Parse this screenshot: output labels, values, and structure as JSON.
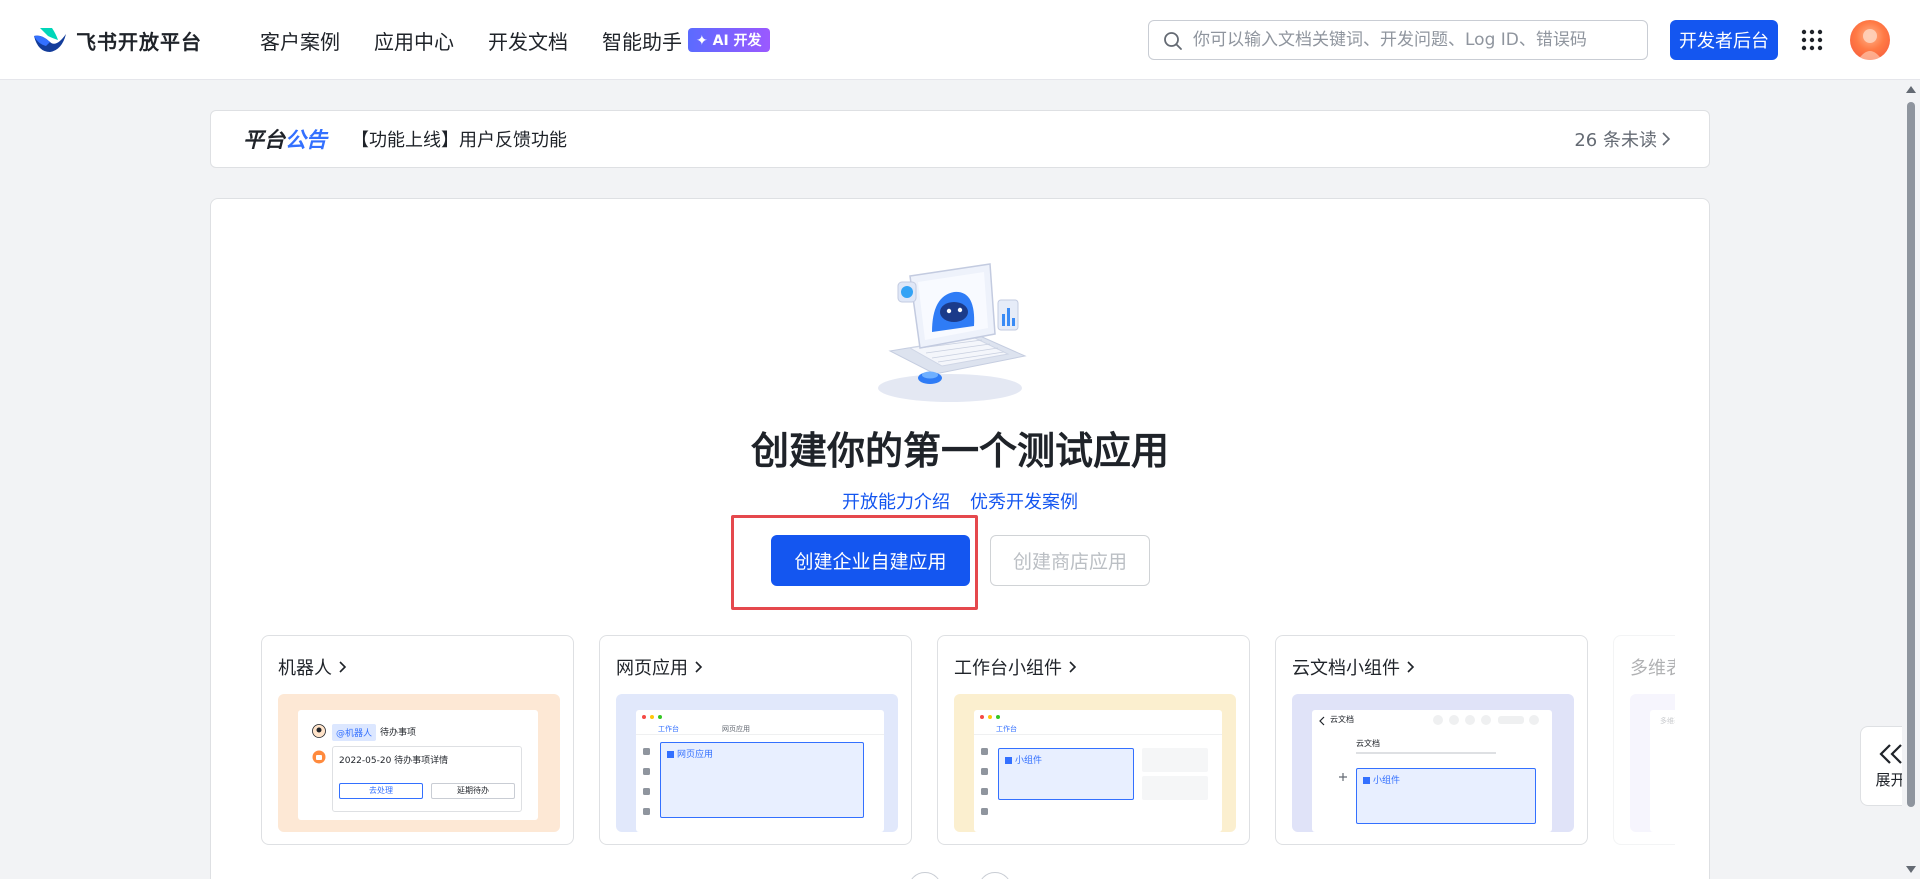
{
  "header": {
    "logo_text": "飞书开放平台",
    "nav": [
      {
        "label": "客户案例"
      },
      {
        "label": "应用中心"
      },
      {
        "label": "开发文档"
      },
      {
        "label": "智能助手",
        "badge": "AI 开发"
      }
    ],
    "search_placeholder": "你可以输入文档关键词、开发问题、Log ID、错误码",
    "dev_console_label": "开发者后台",
    "brand_color": "#1456f0"
  },
  "announcement": {
    "label_part1": "平台",
    "label_part2": "公告",
    "text": "【功能上线】用户反馈功能",
    "unread": "26 条未读"
  },
  "main": {
    "title": "创建你的第一个测试应用",
    "links": [
      "开放能力介绍",
      "优秀开发案例"
    ],
    "primary_button": "创建企业自建应用",
    "secondary_button": "创建商店应用",
    "highlight_color": "#e5484d"
  },
  "app_types": [
    {
      "title": "机器人",
      "preview": {
        "bot_tag": "@机器人",
        "bot_title": "待办事项",
        "item": "2022-05-20 待办事项详情",
        "btn1": "去处理",
        "btn2": "延期待办"
      }
    },
    {
      "title": "网页应用",
      "preview": {
        "tab1": "工作台",
        "tab2": "网页应用",
        "selected": "网页应用"
      }
    },
    {
      "title": "工作台小组件",
      "preview": {
        "tab1": "工作台",
        "selected": "小组件"
      }
    },
    {
      "title": "云文档小组件",
      "preview": {
        "doc_header": "云文档",
        "doc_title": "云文档",
        "selected": "小组件"
      }
    },
    {
      "title": "多维表格",
      "preview": {
        "tag": "多维表格"
      }
    }
  ],
  "expand_tab": {
    "label": "展开"
  }
}
